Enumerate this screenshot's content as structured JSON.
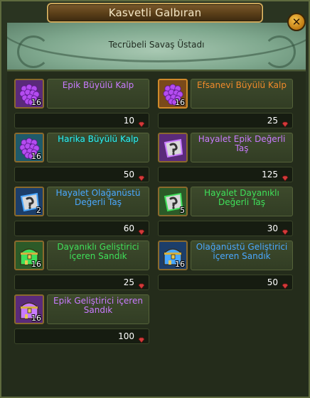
{
  "window": {
    "title": "Kasvetli Galbıran",
    "subtitle": "Tecrübeli Savaş Üstadı",
    "close_label": "✕"
  },
  "colors": {
    "epic": "#c97bff",
    "legendary": "#f08a2a",
    "wondrous": "#2ff0f0",
    "extraordinary": "#4aa8ff",
    "durable": "#3fe05a"
  },
  "items": [
    {
      "name": "Epik Büyülü Kalp",
      "count": "16",
      "price": "10",
      "icon": "purple-heart-icon",
      "rarity": "epic"
    },
    {
      "name": "Efsanevi Büyülü Kalp",
      "count": "16",
      "price": "25",
      "icon": "purple-heart-icon",
      "rarity": "legendary"
    },
    {
      "name": "Harika Büyülü Kalp",
      "count": "16",
      "price": "50",
      "icon": "purple-heart-icon",
      "rarity": "wondrous"
    },
    {
      "name": "Hayalet Epik Değerli Taş",
      "count": "",
      "price": "125",
      "icon": "ghost-gem-icon",
      "rarity": "epic"
    },
    {
      "name": "Hayalet Olağanüstü Değerli Taş",
      "count": "2",
      "price": "60",
      "icon": "ghost-gem-icon",
      "rarity": "extraordinary"
    },
    {
      "name": "Hayalet Dayanıklı Değerli Taş",
      "count": "5",
      "price": "30",
      "icon": "ghost-gem-icon",
      "rarity": "durable"
    },
    {
      "name": "Dayanıklı Geliştirici içeren Sandık",
      "count": "16",
      "price": "25",
      "icon": "chest-icon",
      "rarity": "durable"
    },
    {
      "name": "Olağanüstü Geliştirici içeren Sandık",
      "count": "16",
      "price": "50",
      "icon": "chest-icon",
      "rarity": "extraordinary"
    },
    {
      "name": "Epik Geliştirici içeren Sandık",
      "count": "16",
      "price": "100",
      "icon": "chest-icon",
      "rarity": "epic"
    }
  ],
  "currency_icon": "red-gem-icon"
}
